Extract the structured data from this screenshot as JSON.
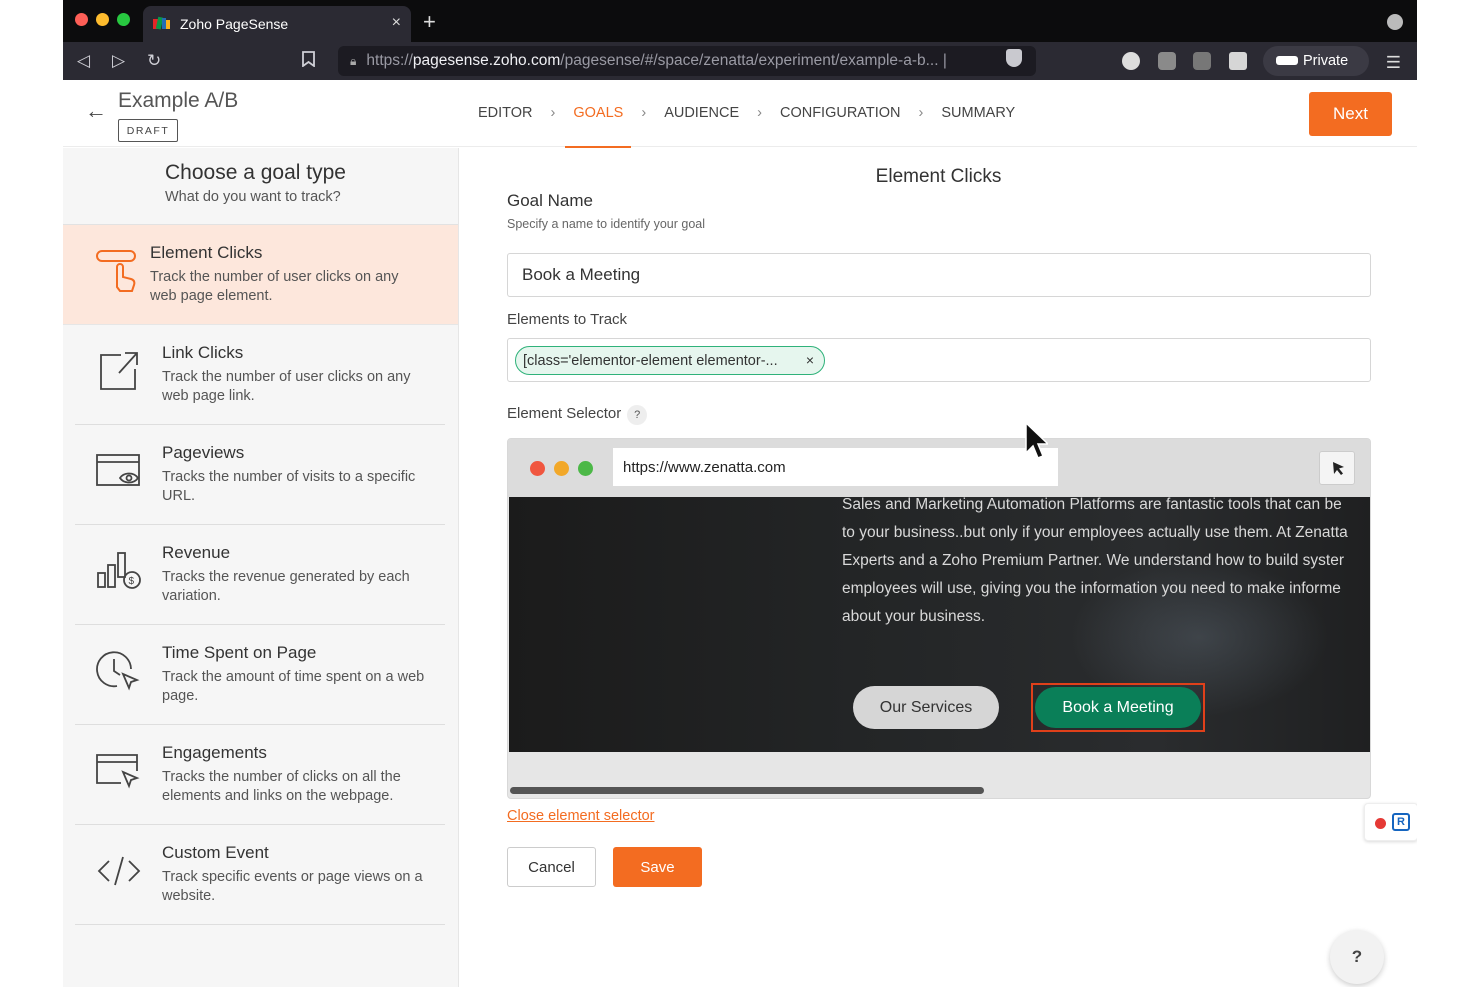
{
  "browser": {
    "tab_title": "Zoho PageSense",
    "tab_close": "×",
    "new_tab": "+",
    "url_prefix": "https://",
    "url_domain": "pagesense.zoho.com",
    "url_path": "/pagesense/#/space/zenatta/experiment/example-a-b... |",
    "private_label": "Private"
  },
  "header": {
    "experiment_title": "Example A/B",
    "status_badge": "DRAFT",
    "steps": [
      "EDITOR",
      "GOALS",
      "AUDIENCE",
      "CONFIGURATION",
      "SUMMARY"
    ],
    "active_step": "GOALS",
    "next_label": "Next"
  },
  "sidebar": {
    "title": "Choose a goal type",
    "subtitle": "What do you want to track?",
    "items": [
      {
        "label": "Element Clicks",
        "desc": "Track the number of user clicks on any web page element.",
        "icon": "pointer-click-icon",
        "selected": true
      },
      {
        "label": "Link Clicks",
        "desc": "Track the number of user clicks on any web page link.",
        "icon": "external-link-icon",
        "selected": false
      },
      {
        "label": "Pageviews",
        "desc": "Tracks the number of visits to a specific URL.",
        "icon": "browser-eye-icon",
        "selected": false
      },
      {
        "label": "Revenue",
        "desc": "Tracks the revenue generated by each variation.",
        "icon": "revenue-chart-icon",
        "selected": false
      },
      {
        "label": "Time Spent on Page",
        "desc": "Track the amount of time spent on a web page.",
        "icon": "clock-cursor-icon",
        "selected": false
      },
      {
        "label": "Engagements",
        "desc": "Tracks the number of clicks on all the elements and links on the webpage.",
        "icon": "browser-cursor-icon",
        "selected": false
      },
      {
        "label": "Custom Event",
        "desc": "Track specific events or page views on a website.",
        "icon": "code-icon",
        "selected": false
      }
    ]
  },
  "main": {
    "panel_title": "Element Clicks",
    "goal_name_label": "Goal Name",
    "goal_name_hint": "Specify a name to identify your goal",
    "goal_name_value": "Book a Meeting",
    "elements_label": "Elements to Track",
    "element_chip": "[class='elementor-element elementor-...",
    "chip_remove": "×",
    "selector_label": "Element Selector",
    "selector_help": "?",
    "preview": {
      "url": "https://www.zenatta.com",
      "text_lines": [
        "Sales and Marketing Automation Platforms are fantastic tools that can be",
        "to your business..but only if your employees actually use them. At Zenatta",
        "Experts and a Zoho Premium Partner. We understand how to build syster",
        "employees will use, giving you the information you need to make informe",
        "about your business."
      ],
      "button_secondary": "Our Services",
      "button_primary": "Book a Meeting"
    },
    "close_selector": "Close element selector",
    "cancel_label": "Cancel",
    "save_label": "Save",
    "help_label": "?"
  },
  "colors": {
    "accent": "#f36c21",
    "selected_bg": "#fde7dc",
    "chip_border": "#2fb27a",
    "preview_button": "#0a7f58",
    "highlight": "#e0401a"
  }
}
